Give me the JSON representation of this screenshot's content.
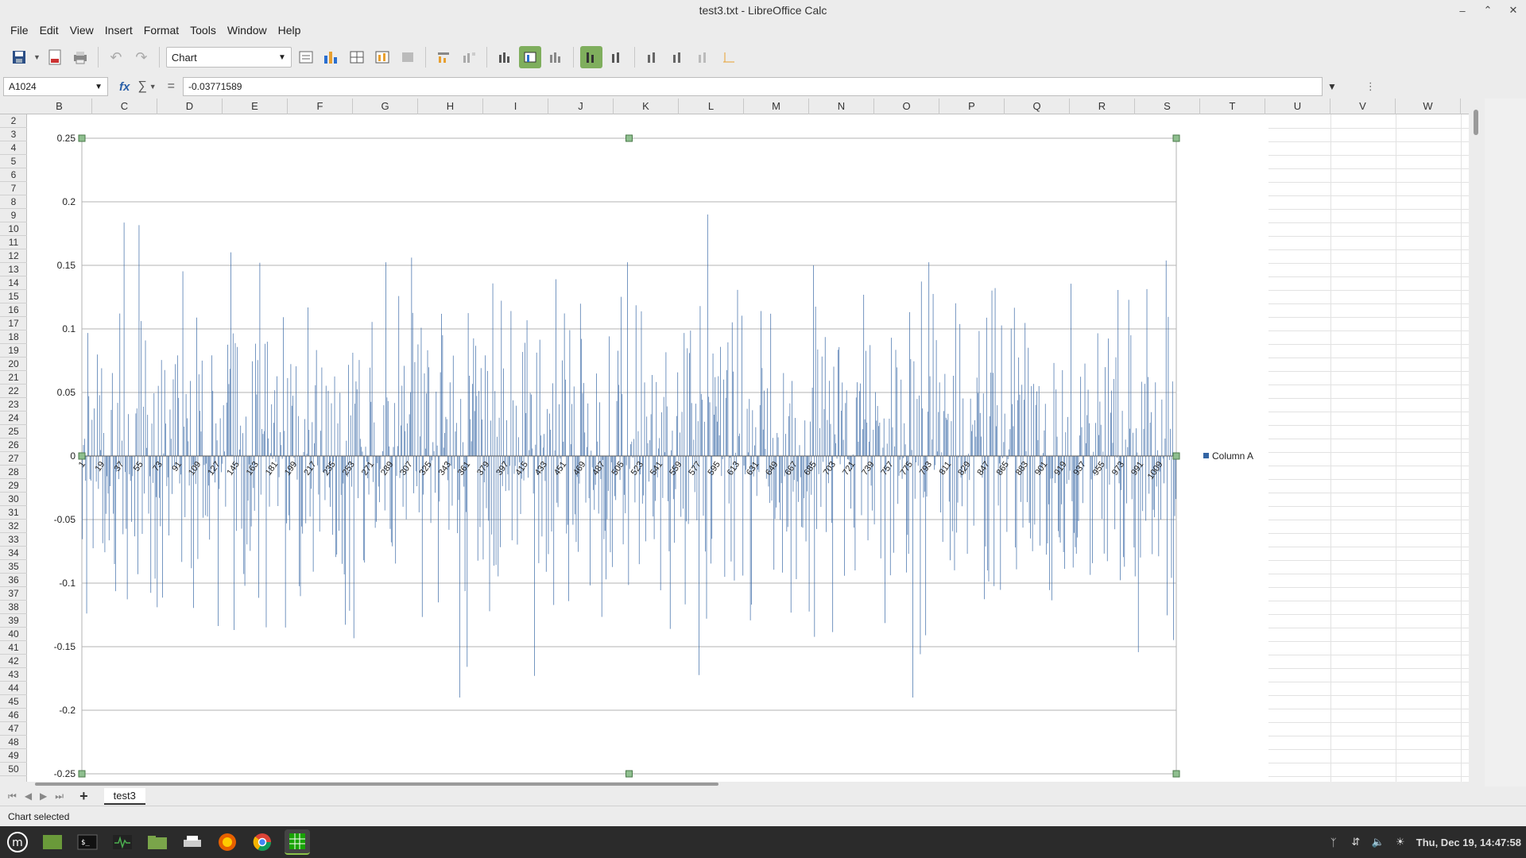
{
  "window": {
    "title": "test3.txt - LibreOffice Calc",
    "buttons": [
      "minimize-icon",
      "restore-icon",
      "close-icon"
    ]
  },
  "menu": [
    "File",
    "Edit",
    "View",
    "Insert",
    "Format",
    "Tools",
    "Window",
    "Help"
  ],
  "toolbar": {
    "element_select": "Chart"
  },
  "formula": {
    "name_box": "A1024",
    "fx_label": "fx",
    "sigma": "∑",
    "equals": "=",
    "value": "-0.03771589"
  },
  "columns": [
    "B",
    "C",
    "D",
    "E",
    "F",
    "G",
    "H",
    "I",
    "J",
    "K",
    "L",
    "M",
    "N",
    "O",
    "P",
    "Q",
    "R",
    "S",
    "T",
    "U",
    "V",
    "W"
  ],
  "rows": [
    "2",
    "3",
    "4",
    "5",
    "6",
    "7",
    "8",
    "9",
    "10",
    "11",
    "12",
    "13",
    "14",
    "15",
    "16",
    "17",
    "18",
    "19",
    "20",
    "21",
    "22",
    "23",
    "24",
    "25",
    "26",
    "27",
    "28",
    "29",
    "30",
    "31",
    "32",
    "33",
    "34",
    "35",
    "36",
    "37",
    "38",
    "39",
    "40",
    "41",
    "42",
    "43",
    "44",
    "45",
    "46",
    "47",
    "48",
    "49",
    "50"
  ],
  "chart_data": {
    "type": "bar",
    "ylim": [
      -0.25,
      0.25
    ],
    "yticks": [
      "0.25",
      "0.2",
      "0.15",
      "0.1",
      "0.05",
      "0",
      "-0.05",
      "-0.1",
      "-0.15",
      "-0.2",
      "-0.25"
    ],
    "xticks": [
      "1",
      "19",
      "37",
      "55",
      "73",
      "91",
      "109",
      "127",
      "145",
      "163",
      "181",
      "199",
      "217",
      "235",
      "253",
      "271",
      "289",
      "307",
      "325",
      "343",
      "361",
      "379",
      "397",
      "415",
      "433",
      "451",
      "469",
      "487",
      "505",
      "523",
      "541",
      "559",
      "577",
      "595",
      "613",
      "631",
      "649",
      "667",
      "685",
      "703",
      "721",
      "739",
      "757",
      "775",
      "793",
      "811",
      "829",
      "847",
      "865",
      "883",
      "901",
      "919",
      "937",
      "955",
      "973",
      "991",
      "1009"
    ],
    "n_points": 1024,
    "series": [
      {
        "name": "Column A",
        "color": "#3465a4"
      }
    ],
    "legend_position": "right",
    "grid": true
  },
  "sheet_tabs": [
    "test3"
  ],
  "status": "Chart selected",
  "clock": "Thu, Dec 19, 14:47:58"
}
